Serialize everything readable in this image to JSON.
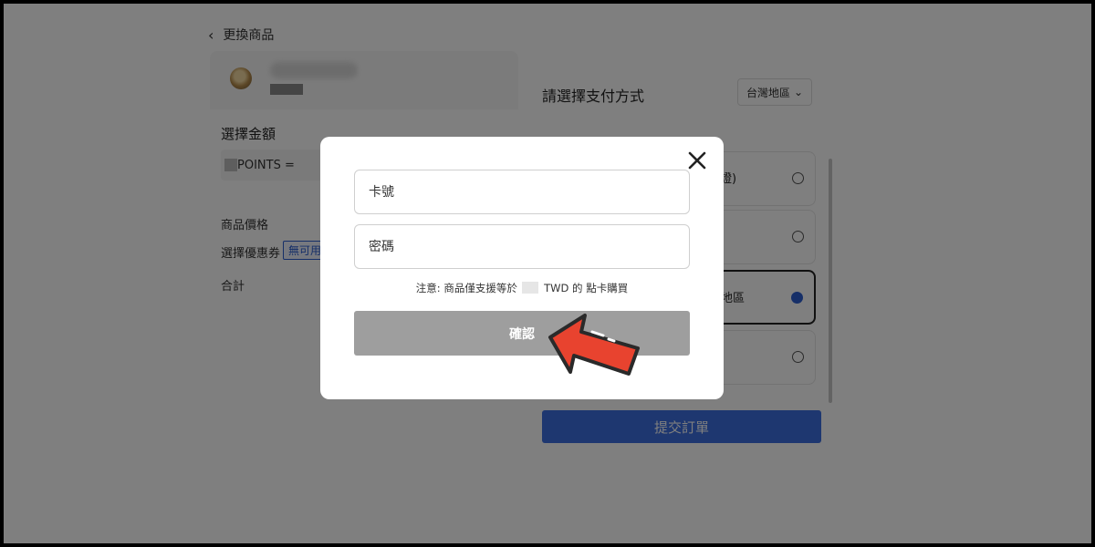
{
  "header": {
    "back_label": "更換商品"
  },
  "amount": {
    "title": "選擇金額",
    "points_label": "POINTS ="
  },
  "summary": {
    "price_label": "商品價格",
    "coupon_label": "選擇優惠券",
    "coupon_badge": "無可用",
    "total_label": "合計"
  },
  "payment": {
    "title": "請選擇支付方式",
    "region": "台灣地區",
    "options": [
      {
        "text": "證)",
        "selected": false
      },
      {
        "text": "",
        "selected": false
      },
      {
        "text": "地區",
        "selected": true
      },
      {
        "text": "",
        "selected": false
      }
    ],
    "submit_label": "提交訂單"
  },
  "modal": {
    "card_placeholder": "卡號",
    "password_placeholder": "密碼",
    "note_prefix": "注意: 商品僅支援等於",
    "note_suffix": "TWD 的 點卡購買",
    "confirm_label": "確認"
  },
  "colors": {
    "accent": "#3d6fe0",
    "arrow": "#e8432f",
    "confirm_disabled": "#9e9e9e"
  }
}
